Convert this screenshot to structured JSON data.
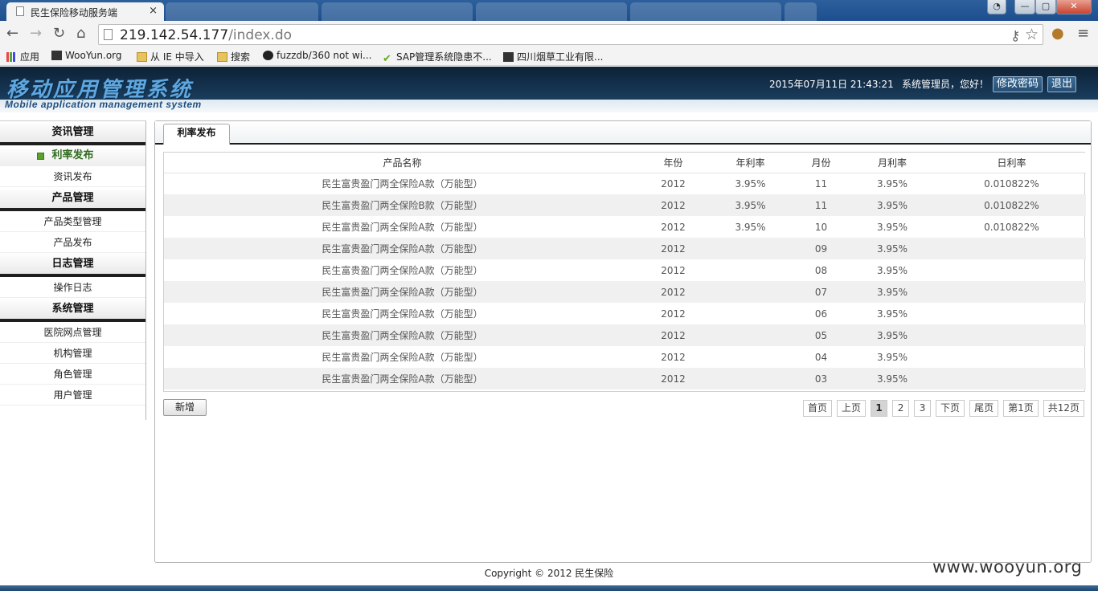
{
  "browser": {
    "tab_title": "民生保险移动服务端",
    "tab_close": "×",
    "url_host": "219.142.54.177",
    "url_path": "/index.do",
    "win_minimize": "—",
    "win_maximize": "▢",
    "win_close": "✕",
    "back": "←",
    "forward": "→",
    "reload": "↻",
    "home": "⌂",
    "star": "☆",
    "key": "⚷",
    "menu": "≡",
    "bookmarks": [
      "应用",
      "WooYun.org",
      "从 IE 中导入",
      "搜索",
      "fuzzdb/360 not wi...",
      "SAP管理系统隐患不...",
      "四川烟草工业有限..."
    ]
  },
  "header": {
    "logo_cn": "移动应用管理系统",
    "logo_en": "Mobile application management system",
    "datetime": "2015年07月11日 21:43:21",
    "greeting": "系统管理员，您好！",
    "change_password": "修改密码",
    "logout": "退出"
  },
  "sidebar": {
    "sections": [
      {
        "title": "资讯管理",
        "items": [
          "利率发布",
          "资讯发布"
        ],
        "active": 0
      },
      {
        "title": "产品管理",
        "items": [
          "产品类型管理",
          "产品发布"
        ]
      },
      {
        "title": "日志管理",
        "items": [
          "操作日志"
        ]
      },
      {
        "title": "系统管理",
        "items": [
          "医院网点管理",
          "机构管理",
          "角色管理",
          "用户管理"
        ]
      }
    ]
  },
  "main": {
    "tab": "利率发布",
    "columns": [
      "产品名称",
      "年份",
      "年利率",
      "月份",
      "月利率",
      "日利率"
    ],
    "rows": [
      [
        "民生富贵盈门两全保险A款（万能型）",
        "2012",
        "3.95%",
        "11",
        "3.95%",
        "0.010822%"
      ],
      [
        "民生富贵盈门两全保险B款（万能型）",
        "2012",
        "3.95%",
        "11",
        "3.95%",
        "0.010822%"
      ],
      [
        "民生富贵盈门两全保险A款（万能型）",
        "2012",
        "3.95%",
        "10",
        "3.95%",
        "0.010822%"
      ],
      [
        "民生富贵盈门两全保险A款（万能型）",
        "2012",
        "",
        "09",
        "3.95%",
        ""
      ],
      [
        "民生富贵盈门两全保险A款（万能型）",
        "2012",
        "",
        "08",
        "3.95%",
        ""
      ],
      [
        "民生富贵盈门两全保险A款（万能型）",
        "2012",
        "",
        "07",
        "3.95%",
        ""
      ],
      [
        "民生富贵盈门两全保险A款（万能型）",
        "2012",
        "",
        "06",
        "3.95%",
        ""
      ],
      [
        "民生富贵盈门两全保险A款（万能型）",
        "2012",
        "",
        "05",
        "3.95%",
        ""
      ],
      [
        "民生富贵盈门两全保险A款（万能型）",
        "2012",
        "",
        "04",
        "3.95%",
        ""
      ],
      [
        "民生富贵盈门两全保险A款（万能型）",
        "2012",
        "",
        "03",
        "3.95%",
        ""
      ]
    ],
    "add_button": "新增",
    "pager": {
      "first": "首页",
      "prev": "上页",
      "pages": [
        "1",
        "2",
        "3"
      ],
      "current": "1",
      "next": "下页",
      "last": "尾页",
      "current_label": "第1页",
      "total_label": "共12页"
    }
  },
  "footer": {
    "copyright": "Copyright © 2012 民生保险"
  },
  "watermark": "www.wooyun.org",
  "colors": {
    "header_dark": "#163654",
    "logo_blue": "#5fa7e0",
    "active_green": "#2e6b1e"
  }
}
